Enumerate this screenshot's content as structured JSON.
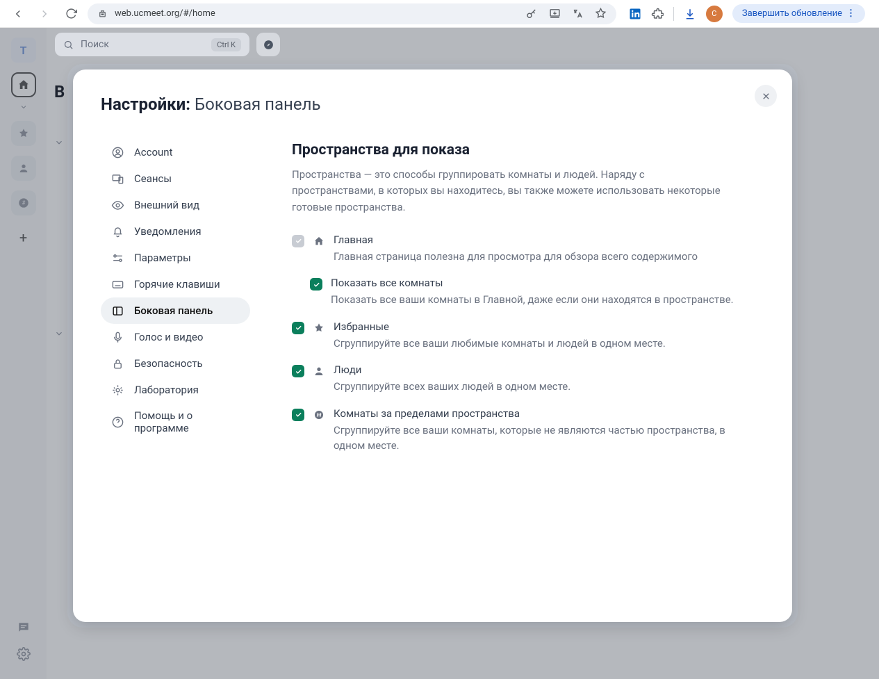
{
  "browser": {
    "url": "web.ucmeet.org/#/home",
    "update_label": "Завершить обновление",
    "avatar_letter": "C"
  },
  "app": {
    "workspace_letter": "T",
    "page_initial": "В",
    "search_placeholder": "Поиск",
    "search_shortcut": "Ctrl K"
  },
  "modal": {
    "title_prefix": "Настройки:",
    "title_section": "Боковая панель",
    "nav": {
      "account": "Account",
      "sessions": "Сеансы",
      "appearance": "Внешний вид",
      "notifications": "Уведомления",
      "preferences": "Параметры",
      "keyboard": "Горячие клавиши",
      "sidebar": "Боковая панель",
      "voice": "Голос и видео",
      "security": "Безопасность",
      "labs": "Лаборатория",
      "help": "Помощь и о программе"
    },
    "content": {
      "heading": "Пространства для показа",
      "description": "Пространства — это способы группировать комнаты и людей. Наряду с пространствами, в которых вы находитесь, вы также можете использовать некоторые готовые пространства.",
      "options": {
        "home": {
          "label": "Главная",
          "sub": "Главная страница полезна для просмотра для обзора всего содержимого"
        },
        "show_all": {
          "label": "Показать все комнаты",
          "sub": "Показать все ваши комнаты в Главной, даже если они находятся в пространстве."
        },
        "favorites": {
          "label": "Избранные",
          "sub": "Сгруппируйте все ваши любимые комнаты и людей в одном месте."
        },
        "people": {
          "label": "Люди",
          "sub": "Сгруппируйте всех ваших людей в одном месте."
        },
        "outside": {
          "label": "Комнаты за пределами пространства",
          "sub": "Сгруппируйте все ваши комнаты, которые не являются частью пространства, в одном месте."
        }
      }
    }
  }
}
